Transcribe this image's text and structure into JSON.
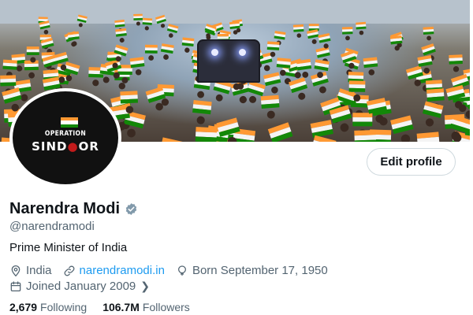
{
  "banner": {
    "description_icon": "crowd-with-flags-image"
  },
  "avatar": {
    "line1": "OPERATION",
    "line2_a": "SIND",
    "line2_dot": "●",
    "line2_b": "OR"
  },
  "actions": {
    "edit_profile": "Edit profile"
  },
  "profile": {
    "name": "Narendra Modi",
    "handle": "@narendramodi",
    "bio": "Prime Minister of India",
    "location": "India",
    "website": "narendramodi.in",
    "born": "Born September 17, 1950",
    "joined": "Joined January 2009",
    "following_count": "2,679",
    "following_label": "Following",
    "followers_count": "106.7M",
    "followers_label": "Followers"
  },
  "colors": {
    "link": "#1d9bf0",
    "muted": "#536471",
    "verified": "#829aab"
  }
}
